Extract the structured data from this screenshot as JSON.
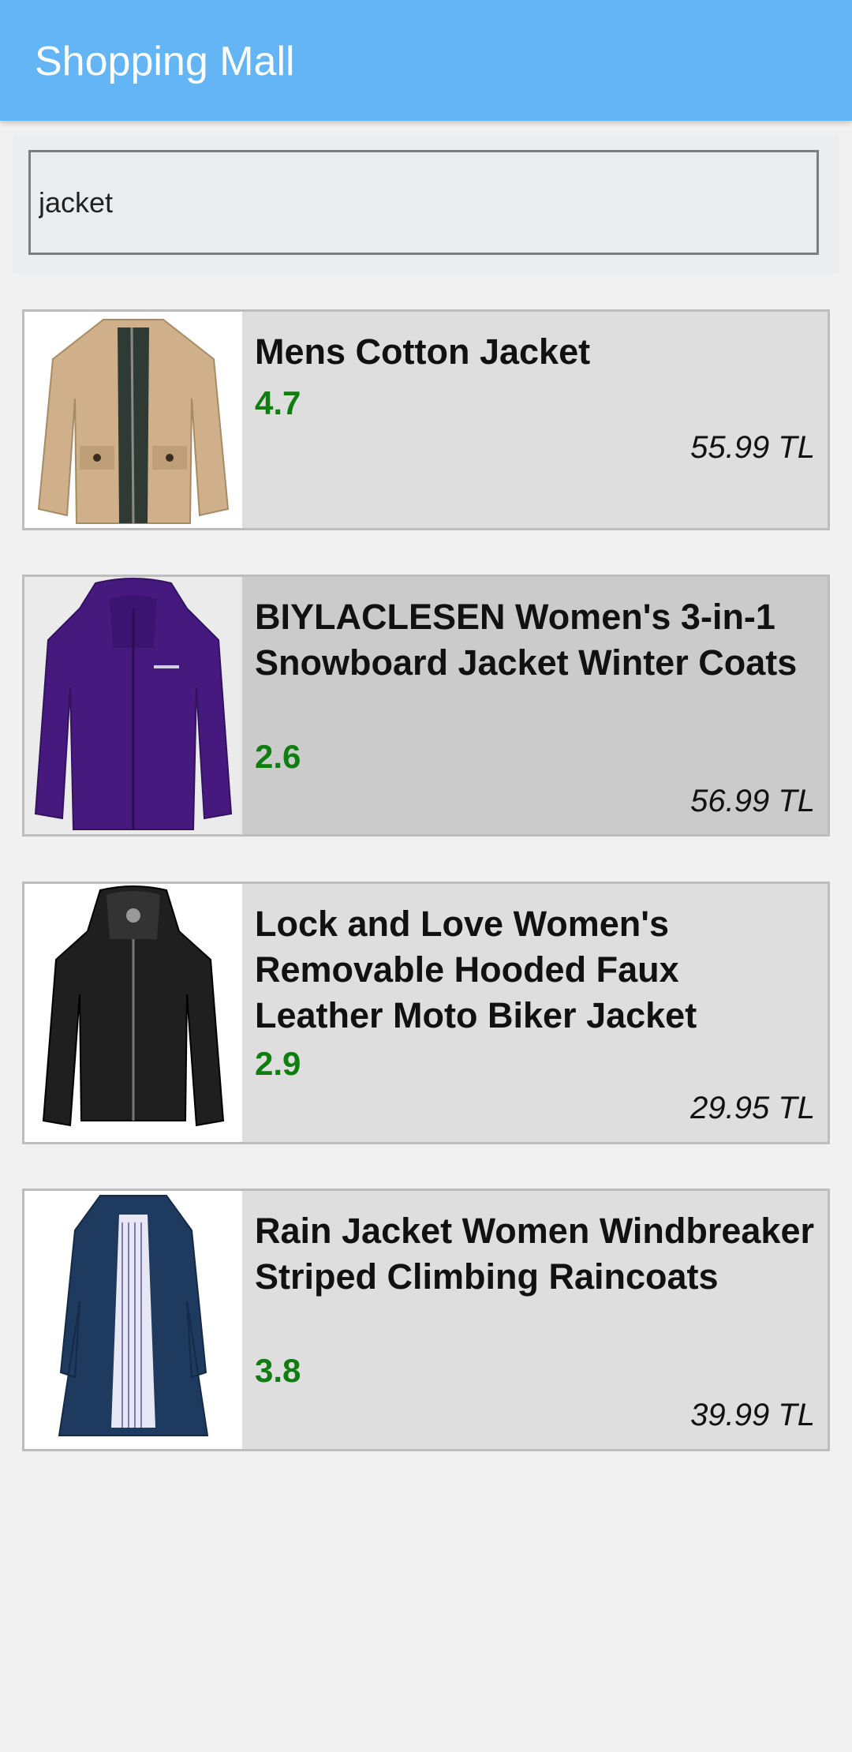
{
  "app": {
    "title": "Shopping Mall"
  },
  "search": {
    "value": "jacket"
  },
  "products": [
    {
      "title": "Mens Cotton Jacket",
      "rating": "4.7",
      "price": "55.99 TL",
      "image_icon": "beige-jacket-image"
    },
    {
      "title": "BIYLACLESEN Women's 3-in-1 Snowboard Jacket Winter Coats",
      "rating": "2.6",
      "price": "56.99 TL",
      "image_icon": "purple-jacket-image"
    },
    {
      "title": "Lock and Love Women's Removable Hooded Faux Leather Moto Biker Jacket",
      "rating": "2.9",
      "price": "29.95 TL",
      "image_icon": "black-leather-jacket-image"
    },
    {
      "title": "Rain Jacket Women Windbreaker Striped Climbing Raincoats",
      "rating": "3.8",
      "price": "39.99 TL",
      "image_icon": "navy-raincoat-image"
    }
  ],
  "colors": {
    "appbar": "#64b5f6",
    "rating": "#0f7d0f",
    "card": "#dedede",
    "card_selected": "#cbcbcb"
  }
}
